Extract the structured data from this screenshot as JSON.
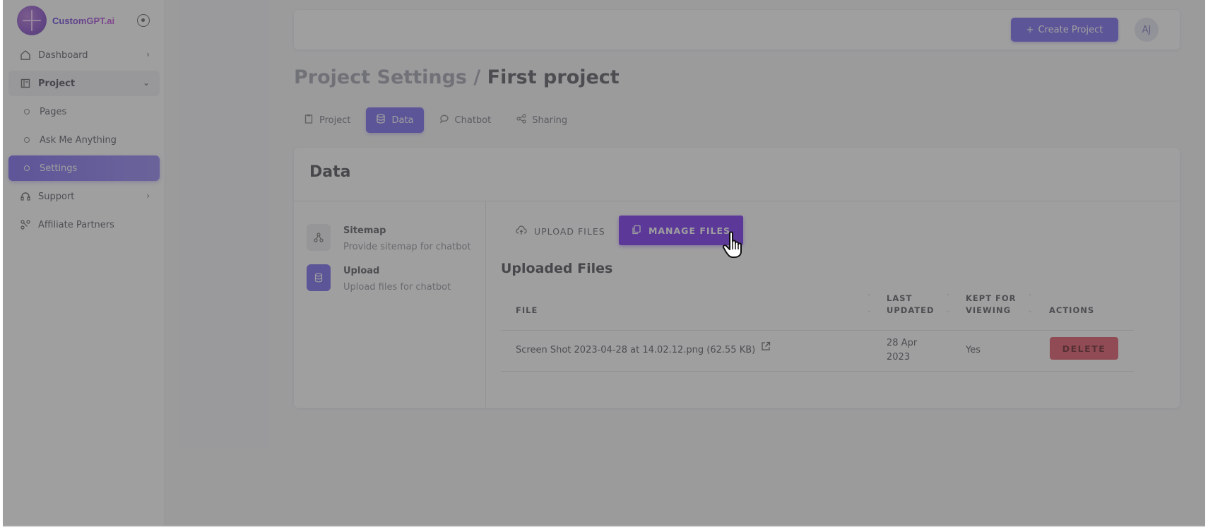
{
  "brand": {
    "name": "CustomGPT.ai"
  },
  "sidebar": {
    "items": [
      {
        "label": "Dashboard",
        "icon": "home-icon"
      },
      {
        "label": "Project",
        "icon": "project-icon"
      },
      {
        "label": "Support",
        "icon": "headset-icon"
      },
      {
        "label": "Affiliate Partners",
        "icon": "partners-icon"
      }
    ],
    "project_sub": [
      {
        "label": "Pages"
      },
      {
        "label": "Ask Me Anything"
      },
      {
        "label": "Settings"
      }
    ]
  },
  "topbar": {
    "create_label": "Create Project",
    "avatar_initials": "AJ"
  },
  "page": {
    "title_prefix": "Project Settings /",
    "title_name": "First project"
  },
  "tabs": [
    {
      "label": "Project",
      "icon": "clipboard-icon"
    },
    {
      "label": "Data",
      "icon": "database-icon"
    },
    {
      "label": "Chatbot",
      "icon": "chat-icon"
    },
    {
      "label": "Sharing",
      "icon": "share-icon"
    }
  ],
  "card": {
    "title": "Data",
    "sources": [
      {
        "title": "Sitemap",
        "desc": "Provide sitemap for chatbot",
        "icon": "sitemap-icon"
      },
      {
        "title": "Upload",
        "desc": "Upload files for chatbot",
        "icon": "upload-db-icon"
      }
    ],
    "upload_tab": "UPLOAD FILES",
    "manage_tab": "MANAGE FILES",
    "uploaded_title": "Uploaded Files",
    "table": {
      "headers": {
        "file": "FILE",
        "last_updated_1": "LAST",
        "last_updated_2": "UPDATED",
        "kept_1": "KEPT FOR",
        "kept_2": "VIEWING",
        "actions": "ACTIONS"
      },
      "rows": [
        {
          "file": "Screen Shot 2023-04-28 at 14.02.12.png (62.55 KB)",
          "date_1": "28 Apr",
          "date_2": "2023",
          "kept": "Yes",
          "action": "DELETE"
        }
      ]
    }
  },
  "colors": {
    "accent": "#6a5cf0",
    "manage_accent": "#6a1cf2",
    "danger": "#e0465a"
  }
}
